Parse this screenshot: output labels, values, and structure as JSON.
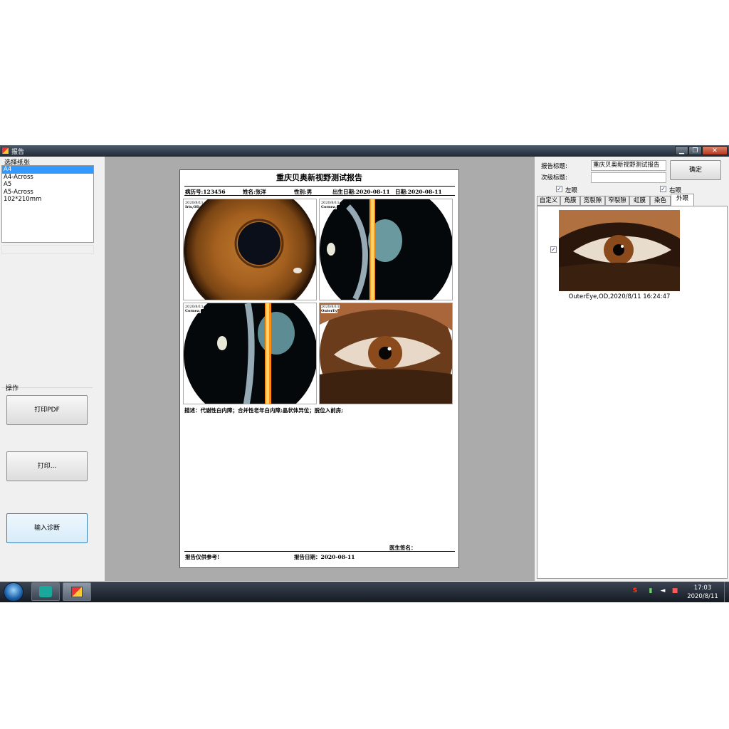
{
  "window": {
    "title": "报告",
    "min_label": "▁",
    "max_label": "❐",
    "close_label": "✕"
  },
  "left_panel": {
    "paper_group_label": "选择纸张",
    "paper_options": [
      "A4",
      "A4-Across",
      "A5",
      "A5-Across",
      "102*210mm"
    ],
    "paper_selected_index": 0,
    "ops_label": "操作",
    "buttons": {
      "print_pdf": "打印PDF",
      "print": "打印...",
      "input_diagnosis": "输入诊断"
    }
  },
  "report": {
    "title": "重庆贝奥新视野测试报告",
    "header": {
      "record_no": "病历号:123456",
      "name": "姓名:张洋",
      "sex": "性别:男",
      "birth": "出生日期:2020-08-11",
      "date": "日期:2020-08-11"
    },
    "photos": [
      {
        "date": "2020/8/11",
        "label": "Iris,OD,"
      },
      {
        "date": "2020/8/11",
        "label": "Cornea,"
      },
      {
        "date": "2020/8/11",
        "label": "Cornea,"
      },
      {
        "date": "2020/8/11",
        "label": "OuterEy"
      }
    ],
    "description": "描述：代谢性白内障；合并性老年白内障;晶状体异位；脱位入前房;",
    "doctor_sign": "医生签名：",
    "footer_note": "报告仅供参考!",
    "footer_date": "报告日期：2020-08-11"
  },
  "right_panel": {
    "report_title_label": "报告标题:",
    "report_title_value": "重庆贝奥新视野测试报告",
    "subtitle_label": "次级标题:",
    "subtitle_value": "",
    "ok_button": "确定",
    "left_eye_label": "左眼",
    "right_eye_label": "右眼",
    "left_eye_checked": true,
    "right_eye_checked": true,
    "tabs": [
      "自定义",
      "角膜",
      "宽裂隙",
      "窄裂隙",
      "虹膜",
      "染色",
      "外眼"
    ],
    "active_tab_index": 6,
    "thumbnail_caption": "OuterEye,OD,2020/8/11 16:24:47",
    "thumbnail_checked": true,
    "check_mark": "✓"
  },
  "taskbar": {
    "time": "17:03",
    "date": "2020/8/11"
  },
  "colors": {
    "selection": "#3399ff",
    "iris": "#9a5a22",
    "slit_beam": "#ff9a1a",
    "taskbar": "#1b222c"
  }
}
